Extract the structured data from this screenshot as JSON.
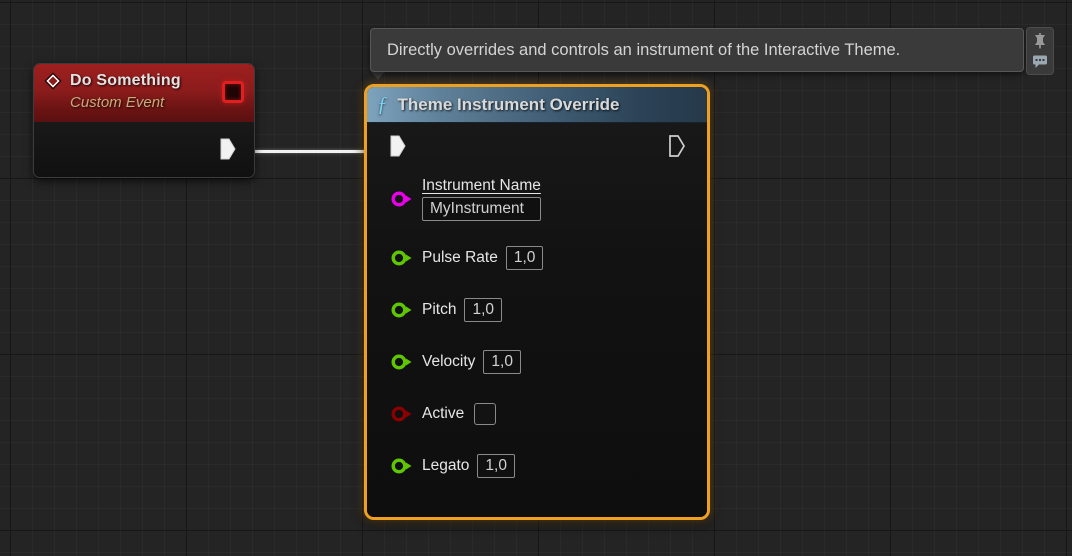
{
  "app": {
    "context": "blueprint-graph",
    "background_color": "#242424"
  },
  "tooltip": {
    "text": "Directly overrides and controls an instrument of the Interactive Theme.",
    "buttons": [
      {
        "name": "pin-icon",
        "label": "Pin tooltip"
      },
      {
        "name": "comment-icon",
        "label": "Show comment"
      }
    ]
  },
  "event_node": {
    "title": "Do Something",
    "subtitle": "Custom Event",
    "icon": "event-diamond-icon",
    "delegate_pin": "delegate-output-pin",
    "exec_output": "exec-output-pin",
    "header_color": "#8c1c1c",
    "delegate_color": "#e02020"
  },
  "function_node": {
    "title": "Theme Instrument Override",
    "icon": "function-f-icon",
    "selected": true,
    "selection_color": "#f0a020",
    "header_color": "#5f8099",
    "exec_in": "exec-input-pin",
    "exec_out": "exec-output-pin",
    "pins": [
      {
        "label": "Instrument Name",
        "value": "MyInstrument",
        "type": "name",
        "color": "#e800e8",
        "widget": "text",
        "underlined": true,
        "stacked": true
      },
      {
        "label": "Pulse Rate",
        "value": "1,0",
        "type": "float",
        "color": "#5ec700",
        "widget": "number",
        "underlined": false,
        "stacked": false
      },
      {
        "label": "Pitch",
        "value": "1,0",
        "type": "float",
        "color": "#5ec700",
        "widget": "number",
        "underlined": false,
        "stacked": false
      },
      {
        "label": "Velocity",
        "value": "1,0",
        "type": "float",
        "color": "#5ec700",
        "widget": "number",
        "underlined": false,
        "stacked": false
      },
      {
        "label": "Active",
        "value": "",
        "type": "bool",
        "color": "#8b0000",
        "widget": "checkbox",
        "checked": false,
        "underlined": false,
        "stacked": false
      },
      {
        "label": "Legato",
        "value": "1,0",
        "type": "float",
        "color": "#5ec700",
        "widget": "number",
        "underlined": false,
        "stacked": false
      }
    ]
  },
  "wire": {
    "name": "exec-wire",
    "color": "#f2f2f2"
  }
}
